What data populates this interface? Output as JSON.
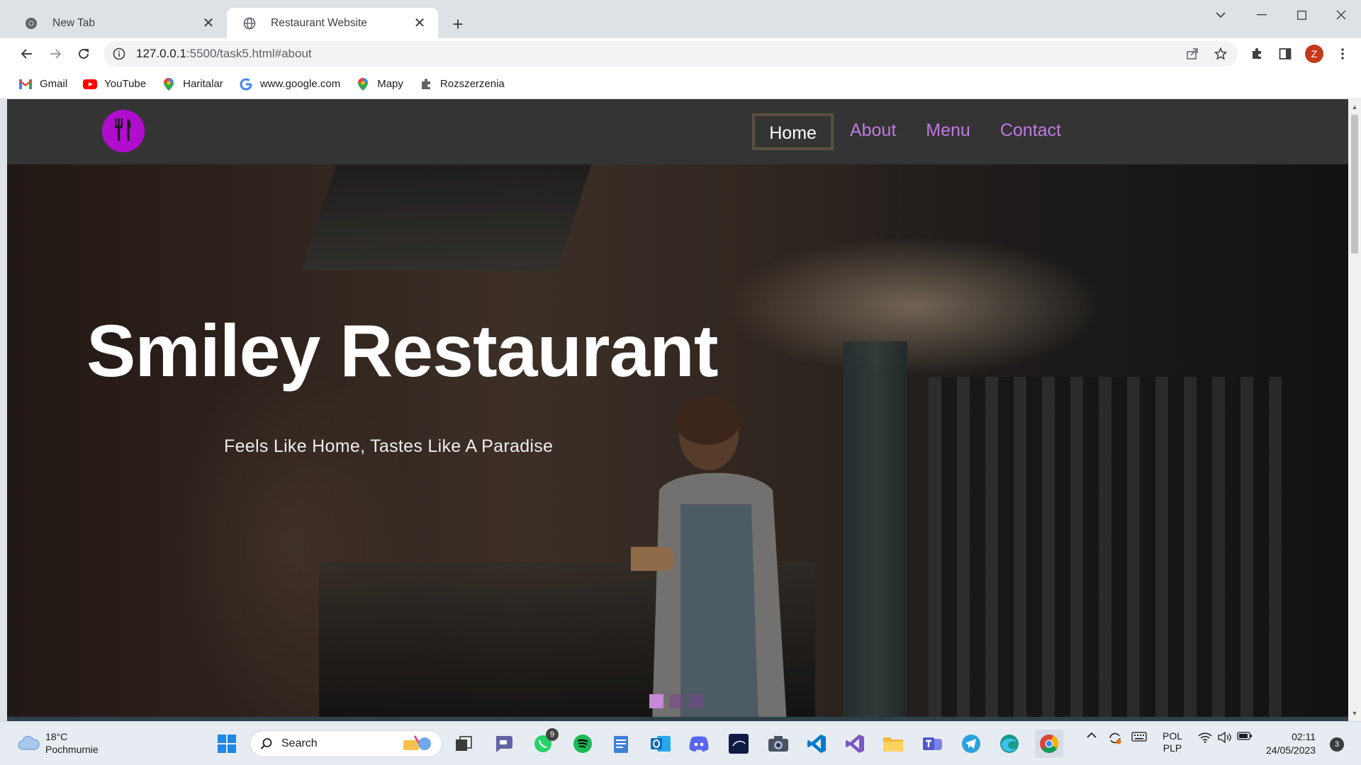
{
  "browser": {
    "tabs": [
      {
        "title": "New Tab",
        "active": false
      },
      {
        "title": "Restaurant Website",
        "active": true
      }
    ],
    "url_host": "127.0.0.1",
    "url_rest": ":5500/task5.html#about",
    "profile_initial": "Z",
    "bookmarks": [
      {
        "label": "Gmail",
        "icon": "gmail-icon"
      },
      {
        "label": "YouTube",
        "icon": "youtube-icon"
      },
      {
        "label": "Haritalar",
        "icon": "maps-pin-icon"
      },
      {
        "label": "www.google.com",
        "icon": "google-icon"
      },
      {
        "label": "Mapy",
        "icon": "maps-pin-icon"
      },
      {
        "label": "Rozszerzenia",
        "icon": "puzzle-icon"
      }
    ]
  },
  "site": {
    "nav": [
      {
        "label": "Home",
        "active": true
      },
      {
        "label": "About",
        "active": false
      },
      {
        "label": "Menu",
        "active": false
      },
      {
        "label": "Contact",
        "active": false
      }
    ],
    "hero_title": "Smiley Restaurant",
    "hero_subtitle": "Feels Like Home, Tastes Like A Paradise",
    "slides": {
      "count": 3,
      "active_index": 0
    },
    "colors": {
      "accent": "#b10dcf",
      "nav_link": "#c07ae0",
      "header_bg": "#343434"
    }
  },
  "taskbar": {
    "weather_temp": "18°C",
    "weather_condition": "Pochmurnie",
    "search_placeholder": "Search",
    "whatsapp_badge": "9",
    "language": "POL",
    "keyboard_layout": "PLP",
    "time": "02:11",
    "date": "24/05/2023",
    "notifications": "3"
  }
}
